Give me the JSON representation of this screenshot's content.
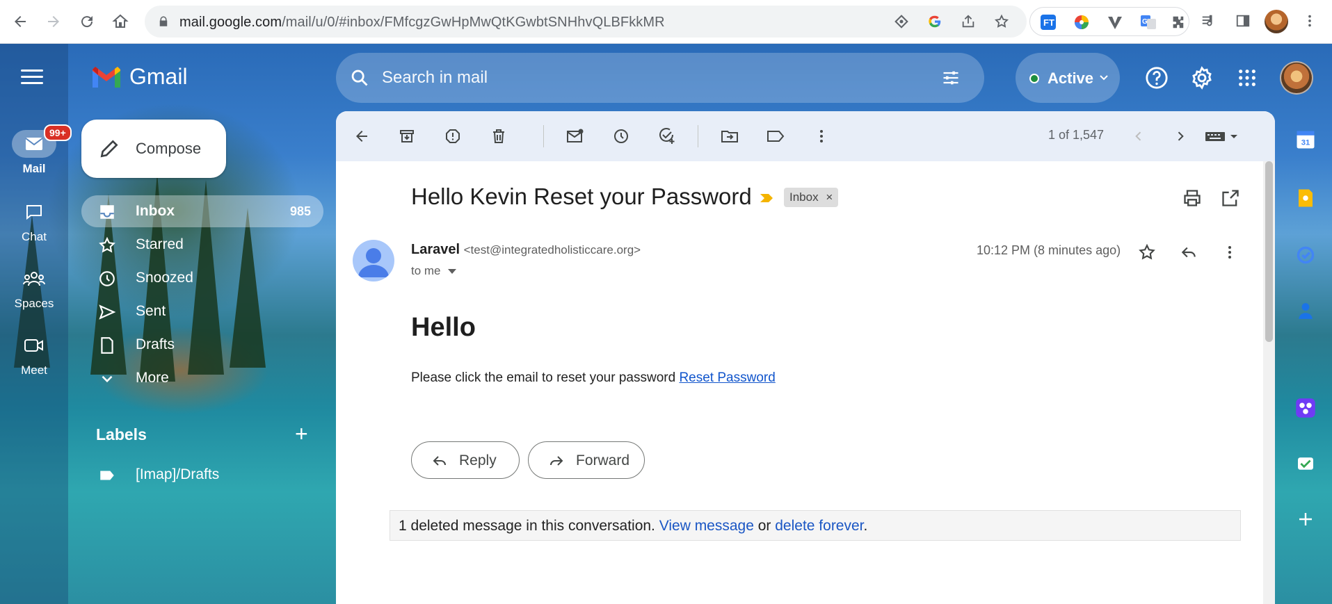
{
  "browser": {
    "url_host": "mail.google.com",
    "url_path": "/mail/u/0/#inbox/FMfcgzGwHpMwQtKGwbtSNHhvQLBFkkMR",
    "back_icon": "arrow-back-icon",
    "forward_icon": "arrow-forward-icon",
    "reload_icon": "reload-icon",
    "home_icon": "home-icon",
    "extensions": [
      "ft-extension-icon",
      "color-wheel-extension-icon",
      "v-extension-icon",
      "translate-extension-icon",
      "puzzle-icon"
    ]
  },
  "app": {
    "name": "Gmail",
    "search_placeholder": "Search in mail",
    "status": "Active"
  },
  "rail": {
    "mail_label": "Mail",
    "mail_badge": "99+",
    "chat_label": "Chat",
    "spaces_label": "Spaces",
    "meet_label": "Meet"
  },
  "nav": {
    "compose_label": "Compose",
    "items": [
      {
        "label": "Inbox",
        "count": "985",
        "icon": "inbox-icon"
      },
      {
        "label": "Starred",
        "count": "",
        "icon": "star-icon"
      },
      {
        "label": "Snoozed",
        "count": "",
        "icon": "clock-icon"
      },
      {
        "label": "Sent",
        "count": "",
        "icon": "send-icon"
      },
      {
        "label": "Drafts",
        "count": "",
        "icon": "draft-icon"
      },
      {
        "label": "More",
        "count": "",
        "icon": "chevron-down-icon"
      }
    ],
    "labels_heading": "Labels",
    "labels": [
      {
        "label": "[Imap]/Drafts"
      }
    ]
  },
  "toolbar": {
    "pager": "1 of 1,547"
  },
  "message": {
    "subject": "Hello Kevin Reset your Password",
    "label_chip": "Inbox",
    "label_chip_close": "×",
    "sender_name": "Laravel",
    "sender_email": "<test@integratedholisticcare.org>",
    "to": "to me",
    "time": "10:12 PM (8 minutes ago)",
    "heading": "Hello",
    "body": "Please click the email to reset your password ",
    "link": "Reset Password",
    "reply_label": "Reply",
    "forward_label": "Forward",
    "deleted_notice": "1 deleted message in this conversation. ",
    "view_message": "View message",
    "or_text": " or ",
    "delete_forever": "delete forever",
    "period": "."
  },
  "colors": {
    "accent_blue": "#1a73e8",
    "badge_red": "#d93025",
    "active_green": "#1e8e3e",
    "important_yellow": "#f4b400"
  }
}
